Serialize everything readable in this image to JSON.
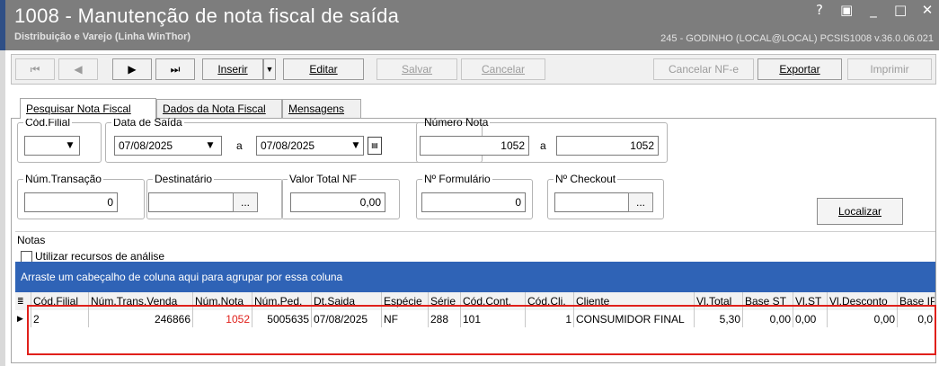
{
  "window": {
    "title": "1008 - Manutenção de nota fiscal de saída",
    "subtitle": "Distribuição e Varejo (Linha WinThor)",
    "system_info": "245 - GODINHO (LOCAL@LOCAL)  PCSIS1008  v.36.0.06.021",
    "controls": {
      "help": "?",
      "restore": "▣",
      "minimize": "_",
      "maximize": "□",
      "close": "✕"
    }
  },
  "toolbar": {
    "first": "⏮",
    "prev": "◀",
    "next": "▶",
    "last": "⏭",
    "inserir": "Inserir",
    "editar": "Editar",
    "salvar": "Salvar",
    "cancelar": "Cancelar",
    "cancelar_nfe": "Cancelar NF-e",
    "exportar": "Exportar",
    "imprimir": "Imprimir"
  },
  "tabs": [
    {
      "label": "Pesquisar Nota Fiscal",
      "active": true
    },
    {
      "label": "Dados da Nota Fiscal",
      "active": false
    },
    {
      "label": "Mensagens",
      "active": false
    }
  ],
  "filters": {
    "cod_filial": {
      "label": "Cód.Filial",
      "value": ""
    },
    "data_saida": {
      "label": "Data de Saída",
      "from": "07/08/2025",
      "separator": "a",
      "to": "07/08/2025"
    },
    "numero_nota": {
      "label": "Número Nota",
      "from": "1052",
      "separator": "a",
      "to": "1052"
    },
    "num_transacao": {
      "label": "Núm.Transação",
      "value": "0"
    },
    "destinatario": {
      "label": "Destinatário",
      "value": "",
      "button": "..."
    },
    "valor_total_nf": {
      "label": "Valor Total NF",
      "value": "0,00"
    },
    "num_formulario": {
      "label": "Nº Formulário",
      "value": "0"
    },
    "num_checkout": {
      "label": "Nº Checkout",
      "value": "",
      "button": "..."
    },
    "localizar": "Localizar"
  },
  "notas": {
    "label": "Notas",
    "analysis_checkbox": {
      "label": "Utilizar recursos de análise",
      "checked": false
    },
    "group_hint": "Arraste um cabeçalho de coluna aqui para agrupar por essa coluna",
    "columns": [
      "Cód.Filial",
      "Núm.Trans.Venda",
      "Núm.Nota",
      "Núm.Ped.",
      "Dt.Saida",
      "Espécie",
      "Série",
      "Cód.Cont.",
      "Cód.Cli.",
      "Cliente",
      "Vl.Total",
      "Base ST",
      "Vl.ST",
      "Vl.Desconto",
      "Base IP"
    ],
    "rows": [
      [
        "2",
        "246866",
        "1052",
        "5005635",
        "07/08/2025",
        "NF",
        "288",
        "101",
        "1",
        "CONSUMIDOR FINAL",
        "5,30",
        "0,00",
        "0,00",
        "0,00",
        "0,0"
      ]
    ],
    "highlight_color": "#e0201b",
    "number_color": "#e0201b"
  }
}
